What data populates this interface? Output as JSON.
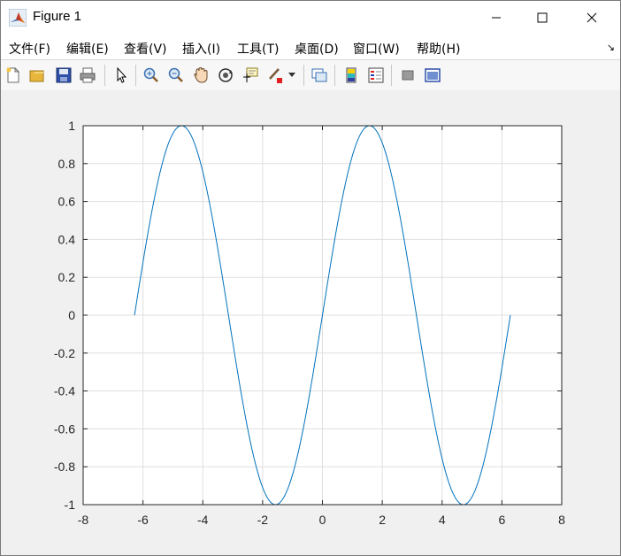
{
  "window": {
    "title": "Figure 1",
    "controls": [
      "minimize",
      "maximize",
      "close"
    ]
  },
  "menu": {
    "items": [
      {
        "label": "文件(F)"
      },
      {
        "label": "编辑(E)"
      },
      {
        "label": "查看(V)"
      },
      {
        "label": "插入(I)"
      },
      {
        "label": "工具(T)"
      },
      {
        "label": "桌面(D)"
      },
      {
        "label": "窗口(W)"
      },
      {
        "label": "帮助(H)"
      }
    ],
    "dock_arrow": "↘"
  },
  "toolbar": {
    "buttons": [
      "new-figure-icon",
      "open-file-icon",
      "save-icon",
      "print-icon",
      "edit-plot-pointer-icon",
      "zoom-in-icon",
      "zoom-out-icon",
      "pan-hand-icon",
      "rotate-3d-icon",
      "data-cursor-icon",
      "brush-icon",
      "link-plot-icon",
      "colorbar-icon",
      "legend-icon",
      "hide-plot-tools-icon",
      "show-plot-tools-icon"
    ]
  },
  "colors": {
    "line": "#0072bd",
    "grid": "#dfdfdf",
    "axes_bg": "#ffffff",
    "figure_bg": "#f0f0f0"
  },
  "chart_data": {
    "type": "line",
    "title": "",
    "xlabel": "",
    "ylabel": "",
    "xlim": [
      -8,
      8
    ],
    "ylim": [
      -1,
      1
    ],
    "xticks": [
      -8,
      -6,
      -4,
      -2,
      0,
      2,
      4,
      6,
      8
    ],
    "yticks": [
      -1,
      -0.8,
      -0.6,
      -0.4,
      -0.2,
      0,
      0.2,
      0.4,
      0.6,
      0.8,
      1
    ],
    "xtick_labels": [
      "-8",
      "-6",
      "-4",
      "-2",
      "0",
      "2",
      "4",
      "6",
      "8"
    ],
    "ytick_labels": [
      "-1",
      "-0.8",
      "-0.6",
      "-0.4",
      "-0.2",
      "0",
      "0.2",
      "0.4",
      "0.6",
      "0.8",
      "1"
    ],
    "grid": true,
    "series": [
      {
        "function": "sin",
        "x": [
          -6.2832,
          -5.8905,
          -5.4978,
          -5.1051,
          -4.7124,
          -4.3197,
          -3.927,
          -3.5343,
          -3.1416,
          -2.7489,
          -2.3562,
          -1.9635,
          -1.5708,
          -1.1781,
          -0.7854,
          -0.3927,
          0,
          0.3927,
          0.7854,
          1.1781,
          1.5708,
          1.9635,
          2.3562,
          2.7489,
          3.1416,
          3.5343,
          3.927,
          4.3197,
          4.7124,
          5.1051,
          5.4978,
          5.8905,
          6.2832
        ],
        "y": [
          0,
          0.3827,
          0.7071,
          0.9239,
          1,
          0.9239,
          0.7071,
          0.3827,
          0,
          -0.3827,
          -0.7071,
          -0.9239,
          -1,
          -0.9239,
          -0.7071,
          -0.3827,
          0,
          0.3827,
          0.7071,
          0.9239,
          1,
          0.9239,
          0.7071,
          0.3827,
          0,
          -0.3827,
          -0.7071,
          -0.9239,
          -1,
          -0.9239,
          -0.7071,
          -0.3827,
          0
        ]
      }
    ]
  }
}
